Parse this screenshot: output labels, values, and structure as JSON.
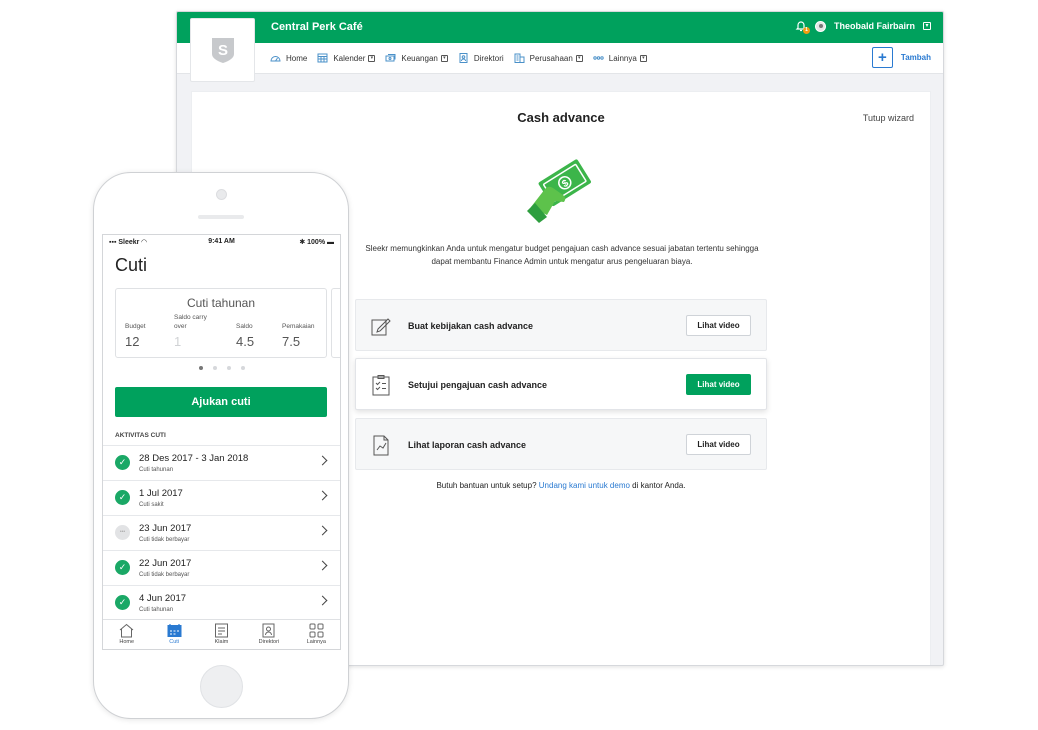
{
  "desktop": {
    "app_title": "Central Perk Café",
    "notification_count": "1",
    "user_name": "Theobald Fairbairn",
    "logo_letter": "S",
    "nav": [
      {
        "label": "Home",
        "icon": "dashboard-icon",
        "caret": false
      },
      {
        "label": "Kalender",
        "icon": "calendar-icon",
        "caret": true
      },
      {
        "label": "Keuangan",
        "icon": "money-icon",
        "caret": true
      },
      {
        "label": "Direktori",
        "icon": "directory-icon",
        "caret": false
      },
      {
        "label": "Perusahaan",
        "icon": "building-icon",
        "caret": true
      },
      {
        "label": "Lainnya",
        "icon": "more-icon",
        "caret": true
      }
    ],
    "add_label": "Tambah",
    "panel": {
      "title": "Cash advance",
      "close_label": "Tutup wizard",
      "description": "Sleekr memungkinkan Anda untuk mengatur budget pengajuan cash advance sesuai jabatan tertentu sehingga dapat membantu Finance Admin untuk mengatur arus pengeluaran biaya.",
      "options": [
        {
          "label": "Buat kebijakan cash advance",
          "button": "Lihat video",
          "icon": "edit-icon"
        },
        {
          "label": "Setujui pengajuan cash advance",
          "button": "Lihat video",
          "icon": "checklist-icon"
        },
        {
          "label": "Lihat laporan cash advance",
          "button": "Lihat video",
          "icon": "report-icon"
        }
      ],
      "help_prefix": "Butuh bantuan untuk setup?",
      "help_link": "Undang kami untuk demo",
      "help_suffix": "di kantor Anda."
    }
  },
  "phone": {
    "status": {
      "carrier": "Sleekr",
      "time": "9:41 AM",
      "battery": "100%"
    },
    "title": "Cuti",
    "card": {
      "title": "Cuti tahunan",
      "stats": [
        {
          "label": "Budget",
          "value": "12"
        },
        {
          "label": "Saldo carry over",
          "value": "1"
        },
        {
          "label": "Saldo",
          "value": "4.5"
        },
        {
          "label": "Pemakaian",
          "value": "7.5"
        }
      ]
    },
    "apply_button": "Ajukan cuti",
    "activity_label": "AKTIVITAS CUTI",
    "activities": [
      {
        "title": "28 Des 2017 - 3 Jan 2018",
        "subtitle": "Cuti tahunan",
        "status": "approved"
      },
      {
        "title": "1 Jul 2017",
        "subtitle": "Cuti sakit",
        "status": "approved"
      },
      {
        "title": "23 Jun 2017",
        "subtitle": "Cuti tidak berbayar",
        "status": "pending"
      },
      {
        "title": "22 Jun 2017",
        "subtitle": "Cuti tidak berbayar",
        "status": "approved"
      },
      {
        "title": "4 Jun 2017",
        "subtitle": "Cuti tahunan",
        "status": "approved"
      }
    ],
    "tabs": [
      {
        "label": "Home",
        "icon": "home-icon"
      },
      {
        "label": "Cuti",
        "icon": "calendar-icon"
      },
      {
        "label": "Klaim",
        "icon": "receipt-icon"
      },
      {
        "label": "Direktori",
        "icon": "contact-icon"
      },
      {
        "label": "Lainnya",
        "icon": "grid-icon"
      }
    ],
    "active_tab": "Cuti"
  },
  "colors": {
    "brand_green": "#00a15d",
    "link_blue": "#2a7ad1"
  }
}
